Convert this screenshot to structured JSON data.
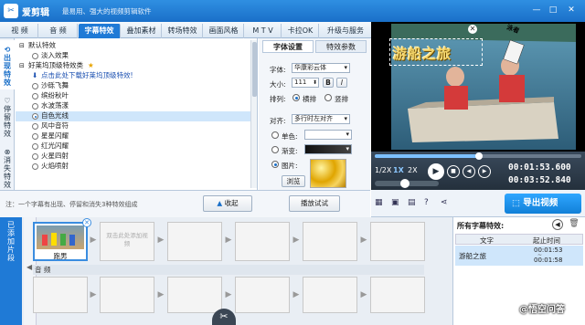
{
  "app": {
    "name": "爱剪辑",
    "slogan": "最易用、强大的视频剪辑软件"
  },
  "tabs": [
    "视 频",
    "音 频",
    "字幕特效",
    "叠加素材",
    "转场特效",
    "画面风格",
    "M T V",
    "卡拉OK",
    "升级与服务"
  ],
  "side_tabs": [
    "出现特效",
    "停留特效",
    "消失特效"
  ],
  "effects": {
    "group_default": "默认特效",
    "fade_in": "淡入效果",
    "group_recommended": "好莱坞顶级特效类",
    "download_link": "点击此处下载好莱坞顶级特效!",
    "items": [
      "沙砾飞舞",
      "缤纷秋叶",
      "水波荡漾",
      "自色光线",
      "风中音符",
      "星星闪耀",
      "红光闪耀",
      "火星四射",
      "火焰喷射"
    ]
  },
  "settings": {
    "tab_font": "字体设置",
    "tab_params": "特效参数",
    "font_label": "字体:",
    "font_value": "华康彩云体",
    "size_label": "大小:",
    "size_value": "111",
    "bold": "B",
    "italic": "I",
    "layout_label": "排列:",
    "horizontal": "横排",
    "vertical": "竖排",
    "align_label": "对齐:",
    "align_value": "多行时左对齐",
    "solid_label": "单色:",
    "gradient_label": "渐变:",
    "image_label": "图片:",
    "browse": "浏览",
    "play_test": "播放试试"
  },
  "hint": "注：一个字幕有出现、停留和消失3种特效组成",
  "collapse_btn": "收起",
  "preview": {
    "caption": "游船之旅",
    "sign": "泳者"
  },
  "playback": {
    "speeds": [
      "1/2X",
      "1X",
      "2X"
    ],
    "time_current": "00:01:53.600",
    "time_total": "00:03:52.840"
  },
  "export_btn": "导出视频",
  "timeline": {
    "side_label": "已添加片段",
    "clip_label": "跑男",
    "placeholder": "双击此处添加视频",
    "audio_label": "音 频"
  },
  "effect_table": {
    "title": "所有字幕特效:",
    "col_text": "文字",
    "col_time": "起止时间",
    "row_text": "游船之旅",
    "row_start": "00:01:53",
    "row_end": "00:01:58"
  },
  "watermark": "@悟空问答",
  "colors": {
    "accent": "#1f7ad6",
    "export": "#1a8fe0"
  }
}
